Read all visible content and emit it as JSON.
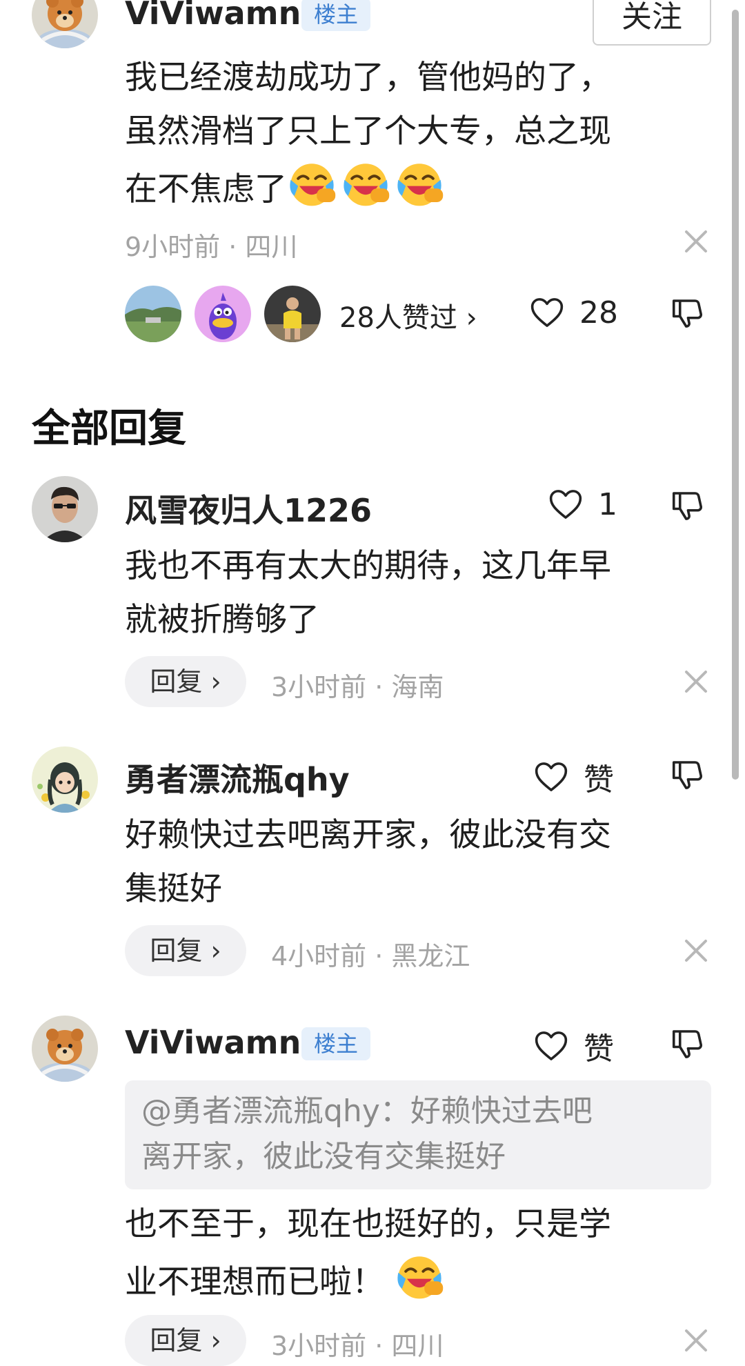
{
  "post": {
    "author": "ViViwamng",
    "op_badge": "楼主",
    "follow_label": "关注",
    "text_lines": [
      "我已经渡劫成功了，管他妈的了，",
      "虽然滑档了只上了个大专，总之现",
      "在不焦虑了"
    ],
    "emoji_name": "crying-laughing-emoji",
    "emoji_count": 3,
    "meta": "9小时前 · 四川",
    "likers_label": "28人赞过 ›",
    "like_count": "28"
  },
  "replies_title": "全部回复",
  "replies": [
    {
      "author": "风雪夜归人1226",
      "like_label": "1",
      "text_lines": [
        "我也不再有太大的期待，这几年早",
        "就被折腾够了"
      ],
      "reply_label": "回复 ›",
      "meta": "3小时前 · 海南"
    },
    {
      "author": "勇者漂流瓶qhy",
      "like_label": "赞",
      "text_lines": [
        "好赖快过去吧离开家，彼此没有交",
        "集挺好"
      ],
      "reply_label": "回复 ›",
      "meta": "4小时前 · 黑龙江"
    },
    {
      "author": "ViViwamng",
      "op_badge": "楼主",
      "like_label": "赞",
      "quote_lines": [
        "@勇者漂流瓶qhy：好赖快过去吧",
        "离开家，彼此没有交集挺好"
      ],
      "text_lines": [
        "也不至于，现在也挺好的，只是学",
        "业不理想而已啦！"
      ],
      "reply_label": "回复 ›",
      "meta": "3小时前 · 四川"
    }
  ],
  "colors": {
    "op_badge_bg": "#e6f0fb",
    "op_badge_text": "#3d7fd0",
    "meta_text": "#a3a3a3",
    "pill_bg": "#f1f1f3"
  }
}
